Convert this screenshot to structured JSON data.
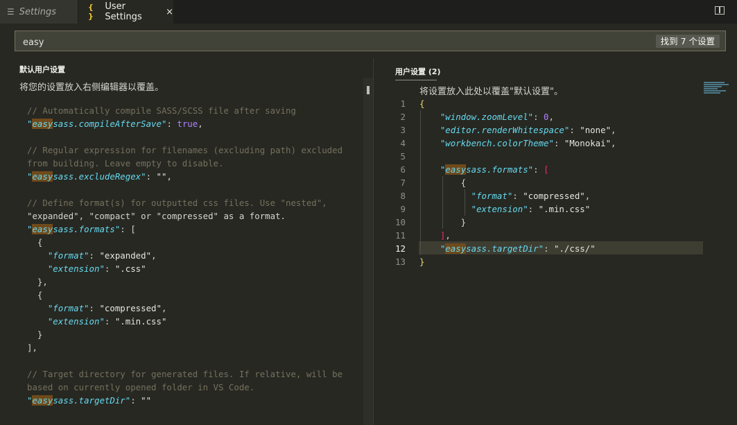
{
  "tabs": [
    {
      "label": "Settings",
      "icon": "settings-lines-icon",
      "active": false
    },
    {
      "label": "User Settings",
      "icon": "braces-icon",
      "active": true,
      "close": "×"
    }
  ],
  "toolbar": {
    "split_icon": "split-editor-icon",
    "more": "···"
  },
  "search": {
    "value": "easy",
    "result_count": "找到 7 个设置"
  },
  "default_settings": {
    "header": "默认用户设置",
    "description": "将您的设置放入右侧编辑器以覆盖。",
    "lines": [
      "// Automatically compile SASS/SCSS file after saving",
      "\"easysass.compileAfterSave\": true,",
      "",
      "// Regular expression for filenames (excluding path) excluded",
      "from building. Leave empty to disable.",
      "\"easysass.excludeRegex\": \"\",",
      "",
      "// Define format(s) for outputted css files. Use \"nested\",",
      "\"expanded\", \"compact\" or \"compressed\" as a format.",
      "\"easysass.formats\": [",
      "  {",
      "    \"format\": \"expanded\",",
      "    \"extension\": \".css\"",
      "  },",
      "  {",
      "    \"format\": \"compressed\",",
      "    \"extension\": \".min.css\"",
      "  }",
      "],",
      "",
      "// Target directory for generated files. If relative, will be",
      "based on currently opened folder in VS Code.",
      "\"easysass.targetDir\": \"\""
    ]
  },
  "user_settings": {
    "header": "用户设置 (2)",
    "description": "将设置放入此处以覆盖\"默认设置\"。",
    "line_numbers": [
      "1",
      "2",
      "3",
      "4",
      "5",
      "6",
      "7",
      "8",
      "9",
      "10",
      "11",
      "12",
      "13"
    ],
    "current_line": 12,
    "lines": [
      "{",
      "    \"window.zoomLevel\": 0,",
      "    \"editor.renderWhitespace\": \"none\",",
      "    \"workbench.colorTheme\": \"Monokai\",",
      "",
      "    \"easysass.formats\": [",
      "        {",
      "          \"format\": \"compressed\",",
      "          \"extension\": \".min.css\"",
      "        }",
      "    ],",
      "    \"easysass.targetDir\": \"./css/\"",
      "}"
    ]
  },
  "colors": {
    "background": "#272822",
    "key": "#66d9ef",
    "comment": "#75715e",
    "match_highlight": "#704a1b"
  }
}
